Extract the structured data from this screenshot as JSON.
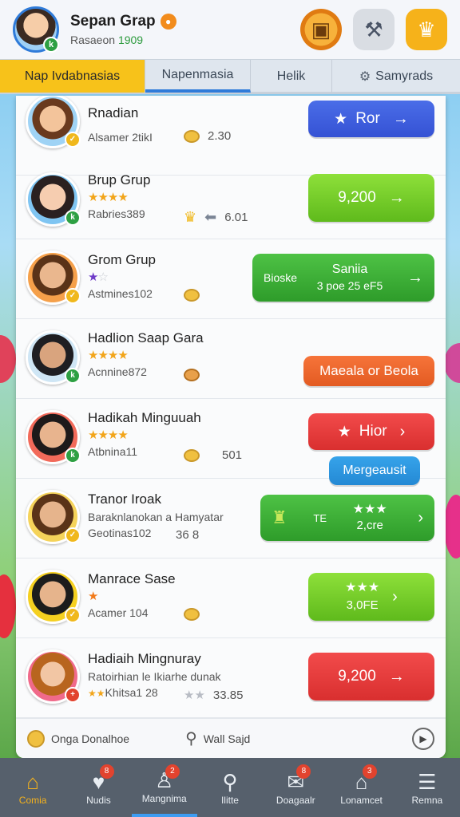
{
  "header": {
    "name": "Sepan Grap",
    "subtitle_prefix": "Rasaeon",
    "subtitle_value": "1909",
    "chest_icon": "treasure-chest-icon",
    "hammer_icon": "hammer-icon",
    "trophy_icon": "trophy-icon"
  },
  "tabs": [
    {
      "label": "Nap Ivdabnasias"
    },
    {
      "label": "Napenmasia"
    },
    {
      "label": "Helik"
    },
    {
      "label": "Samyrads"
    }
  ],
  "rows": [
    {
      "title": "Rnadian",
      "sub": "Alsamer 2tikI",
      "meta": "2.30",
      "button": "Ror"
    },
    {
      "title": "Brup Grup",
      "sub": "Rabries389",
      "meta": "6.01",
      "button": "9,200"
    },
    {
      "title": "Grom Grup",
      "sub": "Astmines102",
      "button_top": "Saniia",
      "button_bottom": "3 poe   25 eF5",
      "button_label_small": "Bioske"
    },
    {
      "title": "Hadlion Saap Gara",
      "sub": "Acnnine872",
      "button": "Maeala or Beola"
    },
    {
      "title": "Hadikah Minguuah",
      "sub": "Atbnina11",
      "meta": "501",
      "button": "Hior",
      "extra_button": "Mergeausit"
    },
    {
      "title": "Tranor Iroak",
      "sub2": "Baraknlanokan a Hamyatar",
      "sub": "Geotinas102",
      "meta": "36 8",
      "button_top": "★★★",
      "button_bottom": "2,cre",
      "button_label_small": "TE"
    },
    {
      "title": "Manrace Sase",
      "sub": "Acamer 104",
      "button_top": "★★★",
      "button_bottom": "3,0FE"
    },
    {
      "title": "Hadiaih Mingnuray",
      "sub2": "Ratoirhian le Ikiarhe dunak",
      "sub": "Khitsa1 28",
      "meta": "33.85",
      "button": "9,200"
    }
  ],
  "footer": {
    "left": "Onga Donalhoe",
    "middle": "Wall Sajd"
  },
  "nav": [
    {
      "label": "Comia",
      "icon": "home-icon"
    },
    {
      "label": "Nudis",
      "icon": "heart-icon",
      "badge": "8"
    },
    {
      "label": "Mangnima",
      "icon": "profile-icon",
      "badge": "2"
    },
    {
      "label": "Ilitte",
      "icon": "search-icon"
    },
    {
      "label": "Doagaalr",
      "icon": "chat-icon",
      "badge": "8"
    },
    {
      "label": "Lonamcet",
      "icon": "shop-icon",
      "badge": "3"
    },
    {
      "label": "Remna",
      "icon": "menu-icon"
    }
  ]
}
